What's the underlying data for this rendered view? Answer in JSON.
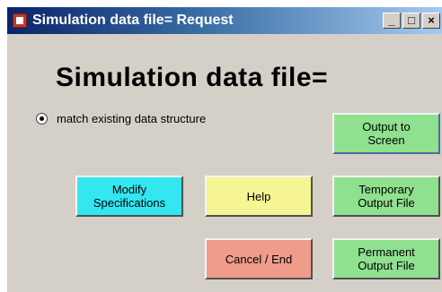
{
  "window": {
    "title": "Simulation data file= Request"
  },
  "controls": {
    "minimize": "_",
    "maximize": "□",
    "close": "×"
  },
  "heading": "Simulation data file=",
  "option": {
    "label": "match existing data structure",
    "selected": true
  },
  "buttons": {
    "output_screen": "Output to\nScreen",
    "modify_specs": "Modify\nSpecifications",
    "help": "Help",
    "temporary_output": "Temporary\nOutput File",
    "cancel_end": "Cancel / End",
    "permanent_output": "Permanent\nOutput File"
  },
  "colors": {
    "green": "#8fe08f",
    "cyan": "#33e6f0",
    "yellow": "#f5f594",
    "salmon": "#ef9c8a",
    "blue": "#8fc3f5"
  }
}
